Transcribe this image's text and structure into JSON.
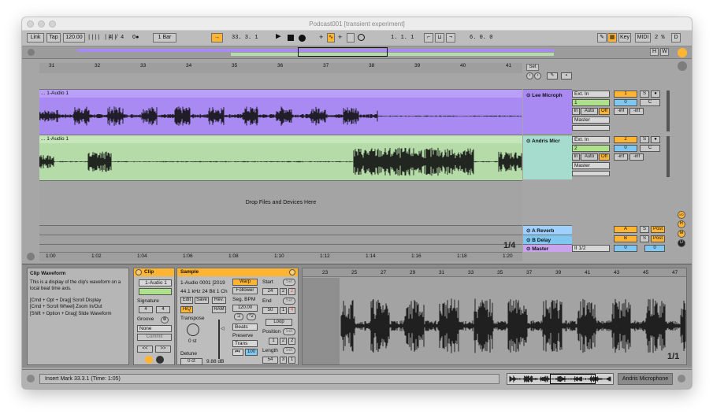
{
  "window": {
    "title": "Podcast001  [transient experiment]"
  },
  "control_bar": {
    "link": "Link",
    "tap": "Tap",
    "tempo": "120.00",
    "tempo_icon": "|||| ||||",
    "sig_num": "4",
    "sig_sep": "/",
    "sig_den": "4",
    "metro": "O●",
    "quant": "1 Bar",
    "position": "33.  3.  1",
    "loop_start": "1.  1.  1",
    "loop_len": "6.  0.  0",
    "key": "Key",
    "midi": "MIDI",
    "cpu": "2 %",
    "d": "D"
  },
  "overview": {
    "h": "H",
    "w": "W"
  },
  "arrangement": {
    "ruler_ticks": [
      "31",
      "32",
      "33",
      "34",
      "35",
      "36",
      "37",
      "38",
      "39",
      "40",
      "41"
    ],
    "set_label": "Set",
    "tracks": [
      {
        "clip_name": "... 1-Audio 1",
        "name": "Lee Microph",
        "input": "Ext. In",
        "channel": "1",
        "monitor": [
          "In",
          "Auto",
          "Off"
        ],
        "output": "Master",
        "number": "1",
        "s": "S",
        "vol": "0",
        "pan": "C",
        "peak_l": "-inf",
        "peak_r": "-inf"
      },
      {
        "clip_name": "... 1-Audio 1",
        "name": "Andris Micr",
        "input": "Ext. In",
        "channel": "2",
        "monitor": [
          "In",
          "Auto",
          "Off"
        ],
        "output": "Master",
        "number": "2",
        "s": "S",
        "vol": "0",
        "pan": "C",
        "peak_l": "-inf",
        "peak_r": "-inf"
      }
    ],
    "drop_text": "Drop Files and Devices Here",
    "returns": [
      {
        "name": "A Reverb",
        "letter": "A",
        "s": "S",
        "post": "Post"
      },
      {
        "name": "B Delay",
        "letter": "B",
        "s": "S",
        "post": "Post"
      },
      {
        "name": "Master",
        "output": "II 1/2",
        "vol": "0",
        "vol2": "0"
      }
    ],
    "time_ticks": [
      "1:00",
      "1:02",
      "1:04",
      "1:06",
      "1:08",
      "1:10",
      "1:12",
      "1:14",
      "1:16",
      "1:18",
      "1:20"
    ],
    "zoom": "1/4",
    "side_letters": [
      "I/O",
      "R",
      "M",
      "D"
    ]
  },
  "info_view": {
    "title": "Clip Waveform",
    "body": "This is a display of the clip's waveform on a local beat time axis.",
    "hints": [
      "[Cmd + Opt + Drag] Scroll Display",
      "[Cmd + Scroll Wheel] Zoom In/Out",
      "[Shift + Option + Drag] Slide Waveform"
    ]
  },
  "clip_panel": {
    "title": "Clip",
    "name": "1-Audio 1",
    "signature_label": "Signature",
    "sig_num": "4",
    "sig_den": "4",
    "groove_label": "Groove",
    "groove": "None",
    "commit": "Commit",
    "nav_left": "<<",
    "nav_right": ">>"
  },
  "sample_panel": {
    "title": "Sample",
    "file": "1-Audio 0001 [2019",
    "format": "44.1 kHz 24 Bit 1 Ch",
    "edit": "Edit",
    "save": "Save",
    "rev": "Rev.",
    "hiq": "HiQ",
    "ram": "RAM",
    "transpose_label": "Transpose",
    "transpose": "0 st",
    "detune_label": "Detune",
    "detune": "0 ct",
    "gain": "9.88 dB",
    "warp": "Warp",
    "follower": "Follower",
    "seg_bpm_label": "Seg. BPM",
    "seg_bpm": "120.00",
    "half": ":2",
    "double": "*2",
    "mode": "Beats",
    "preserve_label": "Preserve",
    "preserve": "Trans",
    "loop_mode": "100",
    "start_label": "Start",
    "start": [
      "24",
      "2",
      "2"
    ],
    "end_label": "End",
    "end": [
      "50",
      "1",
      "4"
    ],
    "loop": "Loop",
    "position_label": "Position",
    "position": [
      "1",
      "2",
      "2"
    ],
    "length_label": "Length",
    "length": [
      "54",
      "3",
      "1"
    ],
    "set": "Set"
  },
  "clip_view": {
    "ticks": [
      "23",
      "25",
      "27",
      "29",
      "31",
      "33",
      "35",
      "37",
      "39",
      "41",
      "43",
      "45",
      "47"
    ],
    "zoom": "1/1"
  },
  "status": {
    "message": "Insert Mark 33.3.1 (Time: 1:05)",
    "track": "Andris Microphone"
  },
  "colors": {
    "purple": "#a98af3",
    "green": "#b5dca8",
    "mixer_green": "#a6dccd",
    "orange": "#ffb532",
    "blue": "#7ec8f2"
  }
}
